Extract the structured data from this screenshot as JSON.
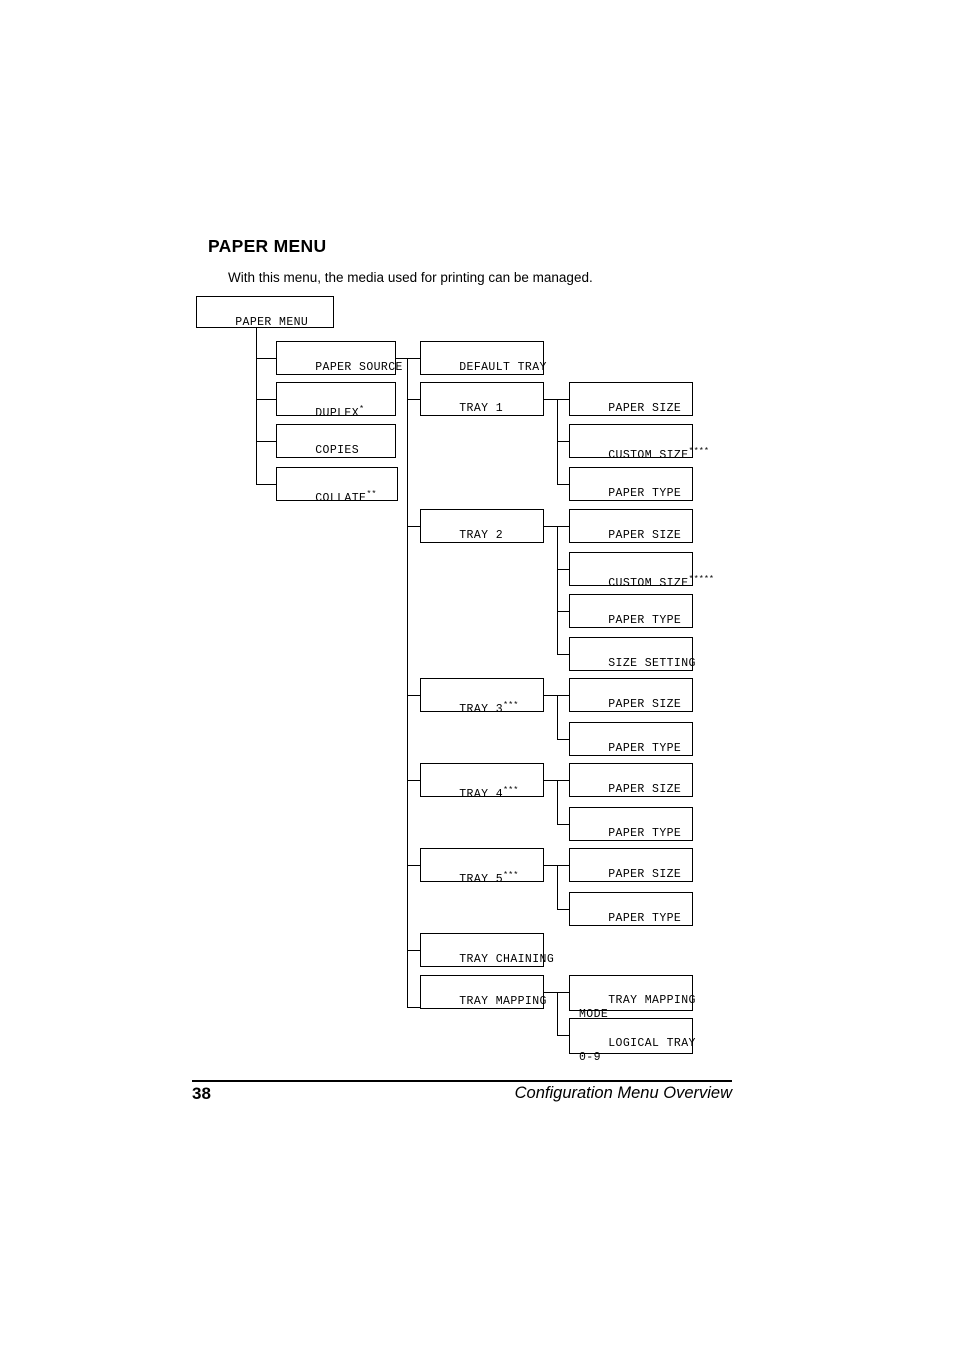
{
  "document": {
    "heading": "PAPER MENU",
    "intro": "With this menu, the media used for printing can be managed.",
    "footer": {
      "page_number": "38",
      "chapter": "Configuration Menu Overview"
    }
  },
  "diagram": {
    "root": {
      "label": "PAPER MENU"
    },
    "level1": [
      {
        "label": "PAPER SOURCE",
        "sup": ""
      },
      {
        "label": "DUPLEX",
        "sup": "*"
      },
      {
        "label": "COPIES",
        "sup": ""
      },
      {
        "label": "COLLATE",
        "sup": "**"
      }
    ],
    "level2": [
      {
        "label": "DEFAULT TRAY",
        "sup": ""
      },
      {
        "label": "TRAY 1",
        "sup": ""
      },
      {
        "label": "TRAY 2",
        "sup": ""
      },
      {
        "label": "TRAY 3",
        "sup": "***"
      },
      {
        "label": "TRAY 4",
        "sup": "***"
      },
      {
        "label": "TRAY 5",
        "sup": "***"
      },
      {
        "label": "TRAY CHAINING",
        "sup": ""
      },
      {
        "label": "TRAY MAPPING",
        "sup": ""
      }
    ],
    "level3": [
      {
        "label": "PAPER SIZE",
        "sup": ""
      },
      {
        "label": "CUSTOM SIZE",
        "sup": "****"
      },
      {
        "label": "PAPER TYPE",
        "sup": ""
      },
      {
        "label": "PAPER SIZE",
        "sup": ""
      },
      {
        "label": "CUSTOM SIZE",
        "sup": "*****"
      },
      {
        "label": "PAPER TYPE",
        "sup": ""
      },
      {
        "label": "SIZE SETTING",
        "sup": ""
      },
      {
        "label": "PAPER SIZE",
        "sup": ""
      },
      {
        "label": "PAPER TYPE",
        "sup": ""
      },
      {
        "label": "PAPER SIZE",
        "sup": ""
      },
      {
        "label": "PAPER TYPE",
        "sup": ""
      },
      {
        "label": "PAPER SIZE",
        "sup": ""
      },
      {
        "label": "PAPER TYPE",
        "sup": ""
      },
      {
        "label": "TRAY MAPPING\nMODE",
        "sup": ""
      },
      {
        "label": "LOGICAL TRAY\n0-9",
        "sup": ""
      }
    ]
  }
}
